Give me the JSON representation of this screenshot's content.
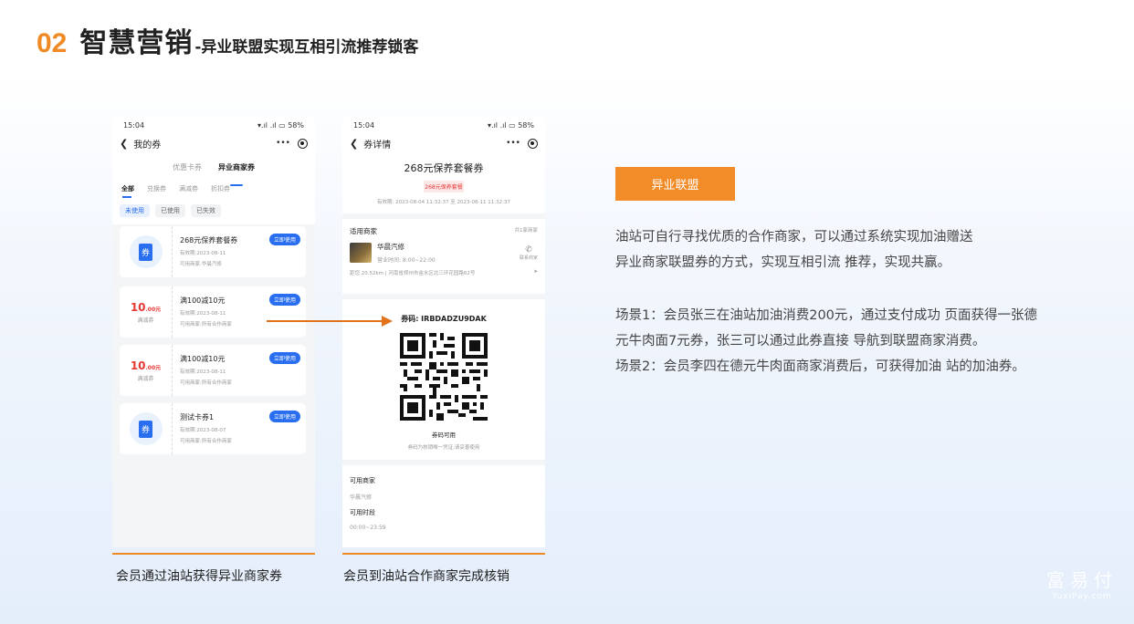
{
  "header": {
    "number": "02",
    "title": "智慧营销",
    "subtitle": "-异业联盟实现互相引流推荐锁客"
  },
  "phone_status": {
    "time": "15:04",
    "battery": "58%",
    "signal": "▾.ıl .ıl"
  },
  "phone1": {
    "nav_title": "我的券",
    "more_label": "•••",
    "top_tabs": [
      "优惠卡券",
      "异业商家券"
    ],
    "sub_tabs": [
      "全部",
      "兑换券",
      "满减券",
      "折扣券"
    ],
    "pills": [
      "未使用",
      "已使用",
      "已失效"
    ],
    "coupons": [
      {
        "kind": "icon",
        "icon_text": "券",
        "title": "268元保养套餐券",
        "line1": "有效期:2023-08-11",
        "line2": "可用商家:华晨汽修",
        "button": "立即使用"
      },
      {
        "kind": "price",
        "price": "10",
        "price_unit": ".00元",
        "price_sub": "满减券",
        "title": "满100减10元",
        "line1": "有效期:2023-08-11",
        "line2": "可用商家:所有合作商家",
        "button": "立即使用"
      },
      {
        "kind": "price",
        "price": "10",
        "price_unit": ".00元",
        "price_sub": "满减券",
        "title": "满100减10元",
        "line1": "有效期:2023-08-11",
        "line2": "可用商家:所有合作商家",
        "button": "立即使用"
      },
      {
        "kind": "icon",
        "icon_text": "券",
        "title": "测试卡券1",
        "line1": "有效期:2023-08-07",
        "line2": "可用商家:所有合作商家",
        "button": "立即使用"
      }
    ]
  },
  "phone2": {
    "nav_title": "券详情",
    "more_label": "•••",
    "coupon_title": "268元保养套餐券",
    "coupon_tag": "268元保养套餐",
    "validity": "有效期: 2023-08-04 11:32:37 至 2023-08-11 11:32:37",
    "merchant_header": "适用商家",
    "merchant_count": "共1家商家",
    "merchant_name": "华晨汽修",
    "merchant_hours": "营业时间:  8:00~22:00",
    "call_label": "联系商家",
    "address": "距您 20.52km | 河南省郑州市金水区北三环花园路62号",
    "code_text": "券码: IRBDADZU9DAK",
    "code_status": "券码可用",
    "code_hint": "券码为核销唯一凭证,请妥善使用",
    "avail_merchant_label": "可用商家",
    "avail_merchant_value": "华晨汽修",
    "avail_time_label": "可用时段",
    "avail_time_value": "00:00~23:59"
  },
  "captions": {
    "left": "会员通过油站获得异业商家券",
    "right": "会员到油站合作商家完成核销"
  },
  "right_panel": {
    "badge": "异业联盟",
    "desc_line1": "油站可自行寻找优质的合作商家，可以通过系统实现加油赠送",
    "desc_line2": "异业商家联盟券的方式，实现互相引流 推荐，实现共赢。",
    "scene_line1": "场景1：会员张三在油站加油消费200元，通过支付成功 页面获得一张德",
    "scene_line2": "元牛肉面7元券，张三可以通过此券直接 导航到联盟商家消费。",
    "scene_line3": "场景2：会员李四在德元牛肉面商家消费后，可获得加油 站的加油券。"
  },
  "watermark": {
    "cn": "富易付",
    "en": "YuxiPay.com"
  },
  "colors": {
    "accent_orange": "#f08a24",
    "brand_blue": "#2a6ef0",
    "price_red": "#e53935"
  }
}
